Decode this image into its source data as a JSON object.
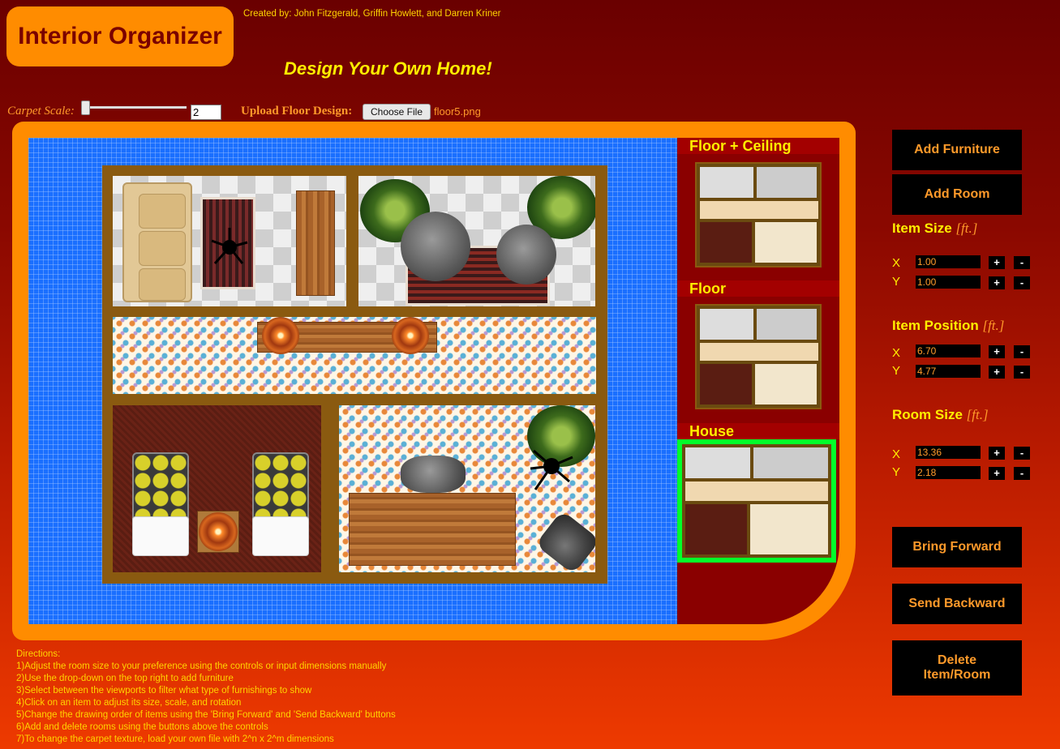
{
  "header": {
    "logo_text": "Interior Organizer",
    "credits": "Created by: John Fitzgerald, Griffin Howlett, and Darren Kriner",
    "tagline": "Design Your Own Home!"
  },
  "toolbar": {
    "carpet_scale_label": "Carpet Scale:",
    "carpet_scale_value": "2",
    "carpet_scale_level": 0.0,
    "upload_label": "Upload Floor Design:",
    "choose_file_label": "Choose File",
    "file_name": "floor5.png"
  },
  "viewports": {
    "floor_ceiling": "Floor + Ceiling",
    "floor": "Floor",
    "house": "House",
    "selected": "House"
  },
  "controls": {
    "add_furniture": "Add Furniture",
    "add_room": "Add Room",
    "unit": "[ft.]",
    "plus": "+",
    "minus": "-",
    "item_size": {
      "title": "Item Size",
      "x_label": "X",
      "y_label": "Y",
      "x": "1.00",
      "y": "1.00"
    },
    "item_position": {
      "title": "Item Position",
      "x_label": "X",
      "y_label": "Y",
      "x": "6.70",
      "y": "4.77"
    },
    "room_size": {
      "title": "Room Size",
      "x_label": "X",
      "y_label": "Y",
      "x": "13.36",
      "y": "2.18"
    },
    "bring_forward": "Bring Forward",
    "send_backward": "Send Backward",
    "delete": "Delete Item/Room"
  },
  "directions": [
    "Directions:",
    "1)Adjust the room size to your preference using the controls or input dimensions manually",
    "2)Use the drop-down on the top right to add furniture",
    "3)Select between the viewports to filter what type of furnishings to show",
    "4)Click on an item to adjust its size, scale, and rotation",
    "5)Change the drawing order of items using the 'Bring Forward' and 'Send Backward' buttons",
    "6)Add and delete rooms using the buttons above the controls",
    "7)To change the carpet texture, load your own file with 2^n x 2^m dimensions"
  ],
  "colors": {
    "accent_orange": "#ff8c00",
    "text_yellow": "#ffee00",
    "canvas_blue": "#1a6fff",
    "selection_green": "#00ff2a"
  }
}
